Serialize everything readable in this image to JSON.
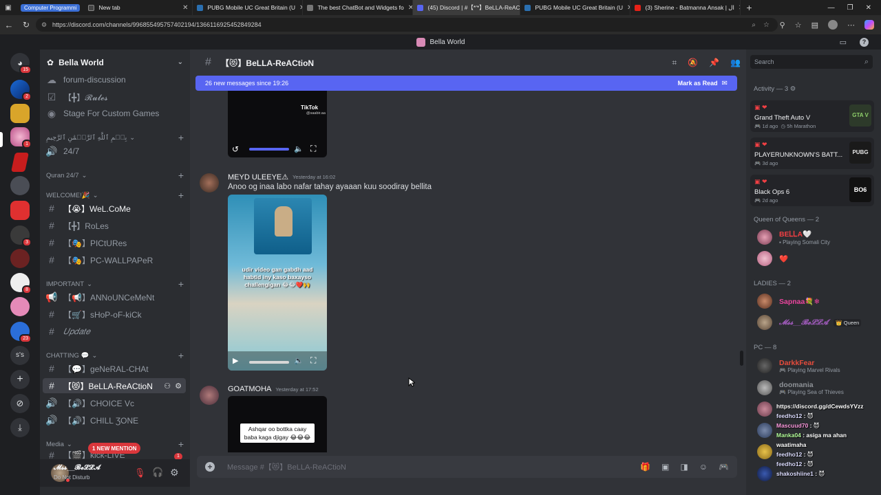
{
  "browser": {
    "tab_group": "Computer Programmi",
    "tabs": [
      {
        "title": "New tab",
        "active": false
      },
      {
        "title": "PUBG Mobile UC Great Britain (U",
        "active": false
      },
      {
        "title": "The best ChatBot and Widgets fo",
        "active": false
      },
      {
        "title": "(45) Discord | #【*'*】BeLLA-ReAC",
        "active": true
      },
      {
        "title": "PUBG Mobile UC Great Britain (U",
        "active": false
      },
      {
        "title": "(3) Sherine - Batmanna Ansak | ال",
        "active": false
      }
    ],
    "url": "https://discord.com/channels/996855495757402194/1366116925452849284"
  },
  "window_title": "Bella World",
  "servers": {
    "badges": [
      "15",
      "2",
      "1",
      "3",
      "8",
      "23"
    ],
    "text_icon": "s's"
  },
  "guild": {
    "name": "Bella World",
    "channels_top": [
      {
        "name": "forum-discussion",
        "icon": "forum-icon"
      },
      {
        "name": "【╋】𝓡𝓾𝓵𝓮𝓼",
        "icon": "checklist-icon"
      },
      {
        "name": "Stage For Custom Games",
        "icon": "stage-icon"
      }
    ],
    "cat_arabic": "بِسۡمِ ٱللَّهِ ٱلرَّحۡمَٰنِ ٱلرَّحِيمِ",
    "ch_247": "24/7",
    "cat_quran": "Quran 24/7",
    "cat_welcome": "WELCOME!🎉",
    "welcome_channels": [
      "【😭】WeL.CoMe",
      "【╋】RoLes",
      "【🎭】PICtURes",
      "【🎭】PC-WALLPAPeR"
    ],
    "cat_important": "IMPORTANT",
    "important_channels": [
      "【📢】ANNoUNCeMeNt",
      "【🛒】sHoP-oF-kiCk",
      "𝑈𝑝𝑑𝑎𝑡𝑒"
    ],
    "cat_chatting": "CHATTING 💬",
    "chatting_channels": [
      "【💬】geNeRAL-CHAt",
      "【😻】BeLLA-ReACtioN",
      "【🔊】CHOICE Vc",
      "【🔊】CHILL ƷONE"
    ],
    "cat_media": "Media",
    "media_channel": "【🎬】kick-LIVE",
    "mention_pill": "1 NEW MENTION",
    "media_badge": "1"
  },
  "user": {
    "name": "𝓜𝓼𝓼__𝓑𝓮𝓛𝓛𝓐",
    "status": "Do Not Disturb"
  },
  "channel": {
    "name": "【😻】BeLLA-ReACtioN",
    "new_messages": "26 new messages since 19:26",
    "mark_read": "Mark as Read",
    "composer_placeholder": "Message #【😻】BeLLA-ReACtioN"
  },
  "messages": [
    {
      "video_watermark": "TikTok",
      "video_sub": "@saabir.aa"
    },
    {
      "author": "MEYD ULEEYE⚠",
      "time": "Yesterday at 16:02",
      "text": "Anoo og inaa labo nafar tahay ayaaan kuu soodiray bellita",
      "video_caption": "udir video gan gabdh aad habtid iny kaso baxayso challengigan 😂😂❤️🙌"
    },
    {
      "author": "GOATMOHA",
      "time": "Yesterday at 17:52",
      "video_caption": "Ashqar oo bottka caay baba kaga djigay 😂😂😂"
    }
  ],
  "right_panel": {
    "search_placeholder": "Search",
    "activity_header": "Activity — 3",
    "activities": [
      {
        "title": "Grand Theft Auto V",
        "sub1": "1d ago",
        "sub2": "5h Marathon",
        "art": "GTA V"
      },
      {
        "title": "PLAYERUNKNOWN'S BATT...",
        "sub1": "3d ago",
        "sub2": "",
        "art": "PUBG"
      },
      {
        "title": "Black Ops 6",
        "sub1": "2d ago",
        "sub2": "",
        "art": "BO6"
      }
    ],
    "queen_header": "Queen of Queens — 2",
    "queens": [
      {
        "name": "BEᏞᏞA🤍",
        "sub": "Playing Somali City",
        "color": "#f23f43"
      },
      {
        "name": "❤️",
        "sub": "",
        "color": "#f23f43"
      }
    ],
    "ladies_header": "LADIES — 2",
    "ladies": [
      {
        "name": "Sapnaa💐❄",
        "sub": "",
        "color": "#eb459e"
      },
      {
        "name": "𝓜𝓼𝓼__𝓑𝓮𝓛𝓛𝓐",
        "sub": "",
        "tag": "👑 Queen",
        "color": "#9b59b6"
      }
    ],
    "pc_header": "PC — 8",
    "pc": [
      {
        "name": "DarkkFear",
        "sub": "Playing Marvel Rivals",
        "color": "#e74c3c"
      },
      {
        "name": "doomania",
        "sub": "Playing Sea of Thieves",
        "color": "#c0c0c0"
      }
    ]
  },
  "overlay_chat": [
    {
      "user": "",
      "msg": "https://discord.gg/dCewdsYVzz",
      "color": "#ffffff"
    },
    {
      "user": "feedho12",
      "msg": ": 😈",
      "color": "#dcdcff"
    },
    {
      "user": "Mascuud70",
      "msg": ": 😈",
      "color": "#ff9be0"
    },
    {
      "user": "Manka04",
      "msg": ": asiga ma ahan",
      "color": "#b4ff9b"
    },
    {
      "user": "",
      "msg": "waatimaha",
      "color": "#ffffff"
    },
    {
      "user": "feedho12",
      "msg": ": 😈",
      "color": "#dcdcff"
    },
    {
      "user": "feedho12",
      "msg": ": 😈",
      "color": "#dcdcff"
    },
    {
      "user": "shakoshiine1",
      "msg": ": 😈",
      "color": "#dcdcff"
    }
  ],
  "colors": {
    "blurple": "#5865f2",
    "dnd_red": "#f23f43",
    "mention_red": "#da373c"
  }
}
